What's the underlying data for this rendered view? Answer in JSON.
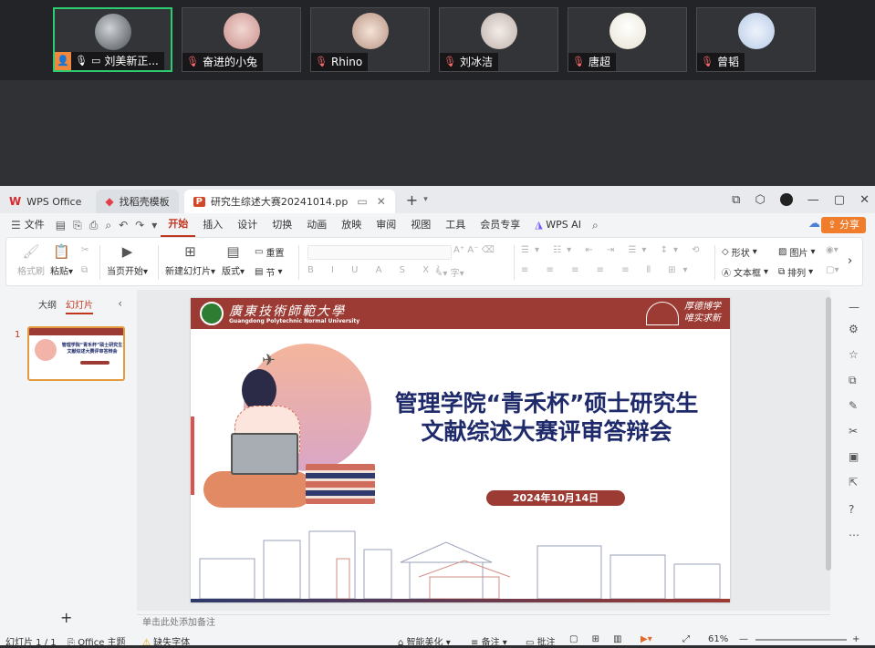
{
  "meeting": {
    "participants": [
      {
        "name": "刘美新正...",
        "host": true,
        "muted": false
      },
      {
        "name": "奋进的小兔",
        "host": false,
        "muted": true
      },
      {
        "name": "Rhino",
        "host": false,
        "muted": true
      },
      {
        "name": "刘冰洁",
        "host": false,
        "muted": true
      },
      {
        "name": "唐超",
        "host": false,
        "muted": true
      },
      {
        "name": "曾韬",
        "host": false,
        "muted": true
      }
    ]
  },
  "window": {
    "tabs": [
      {
        "label": "WPS Office",
        "logo": "W"
      },
      {
        "label": "找稻壳模板",
        "logo": "◆"
      },
      {
        "label": "研究生综述大赛20241014.pp",
        "logo": "P"
      }
    ]
  },
  "menu": {
    "file": "文件",
    "items": [
      "开始",
      "插入",
      "设计",
      "切换",
      "动画",
      "放映",
      "审阅",
      "视图",
      "工具",
      "会员专享"
    ],
    "wps_ai": "WPS AI",
    "share": "分享"
  },
  "ribbon": {
    "format_painter": "格式刷",
    "paste": "粘贴",
    "from_current": "当页开始",
    "new_slide": "新建幻灯片",
    "layout": "版式",
    "reset": "重置",
    "section": "节",
    "shape": "形状",
    "picture": "图片",
    "textbox": "文本框",
    "arrange": "排列"
  },
  "leftpanel": {
    "outline_tab": "大纲",
    "slides_tab": "幻灯片",
    "slide_number": "1"
  },
  "slide": {
    "university_cn": "廣東技術師範大學",
    "university_en": "Guangdong Polytechnic Normal University",
    "motto": "厚德博学 唯实求新",
    "title_line1": "管理学院“青禾杯”硕士研究生",
    "title_line2": "文献综述大赛评审答辩会",
    "date": "2024年10月14日"
  },
  "notes": {
    "placeholder": "单击此处添加备注"
  },
  "status": {
    "slide_count": "幻灯片 1 / 1",
    "theme": "Office 主题",
    "missing_font": "缺失字体",
    "smart_beautify": "智能美化",
    "notes": "备注",
    "comments": "批注",
    "zoom": "61%"
  }
}
